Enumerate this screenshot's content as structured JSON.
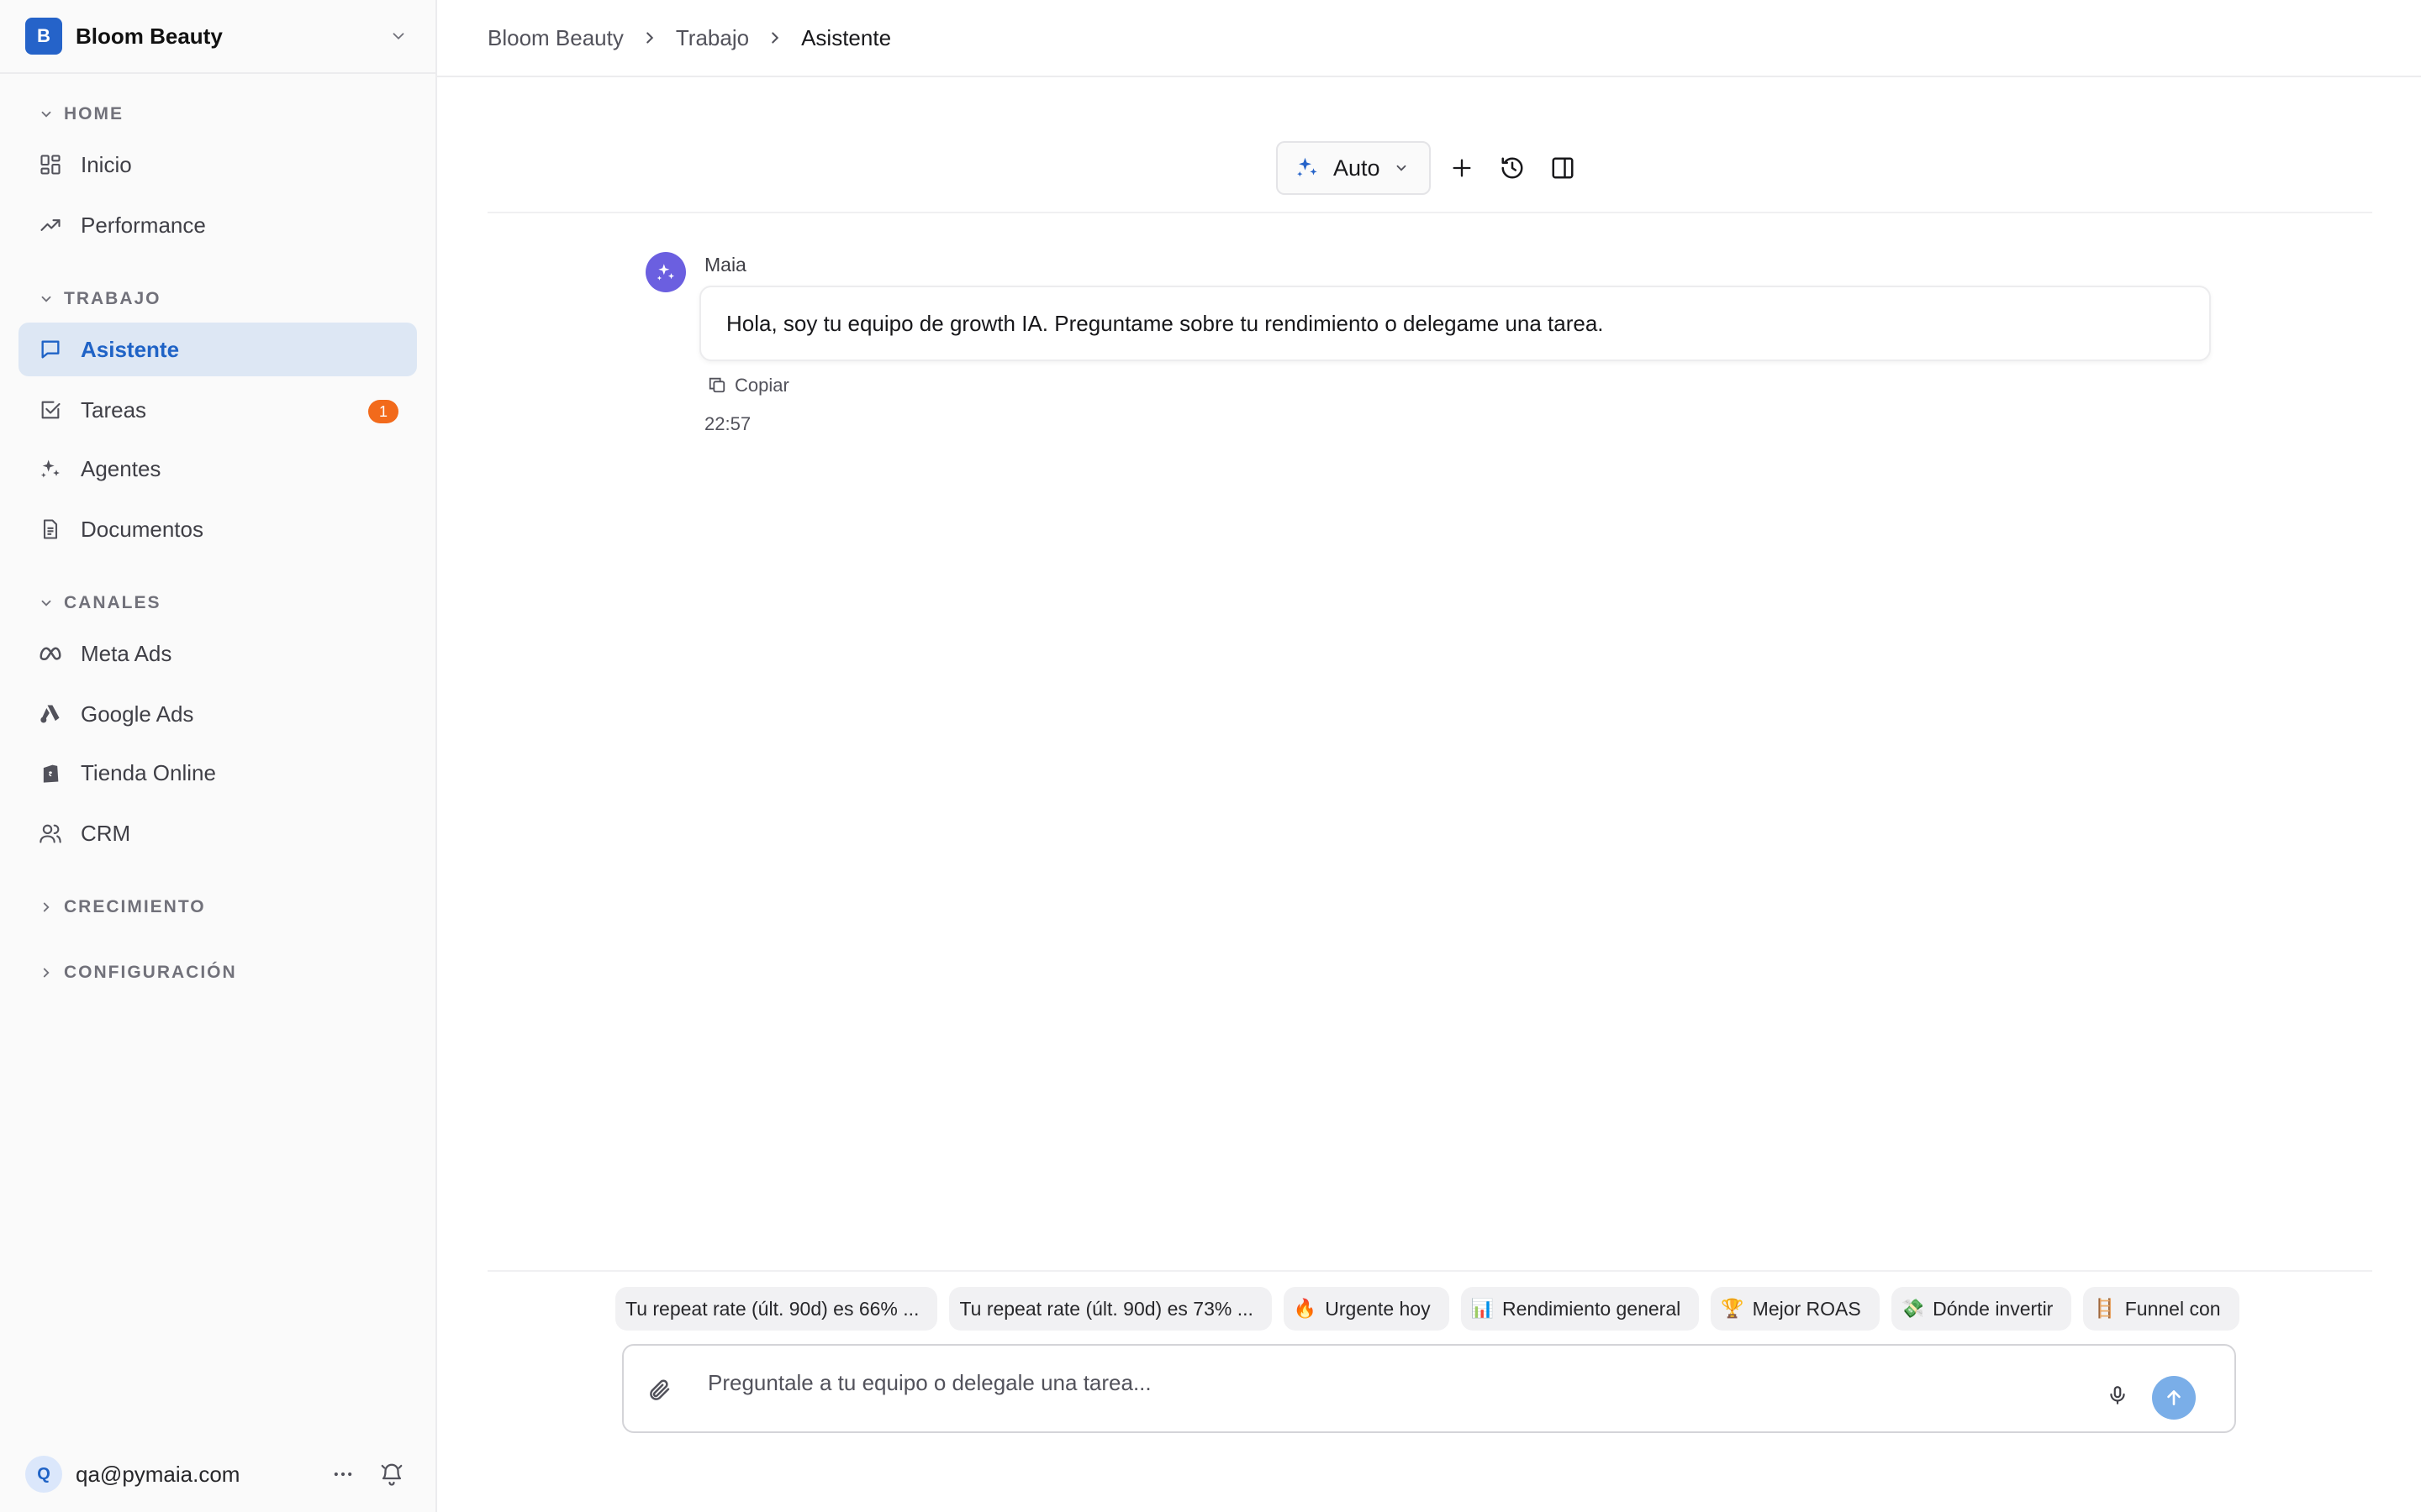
{
  "workspace": {
    "initial": "B",
    "name": "Bloom Beauty"
  },
  "sidebar": {
    "sections": [
      {
        "label": "HOME",
        "items": [
          {
            "label": "Inicio",
            "icon": "grid-icon"
          },
          {
            "label": "Performance",
            "icon": "trending-up-icon"
          }
        ]
      },
      {
        "label": "TRABAJO",
        "items": [
          {
            "label": "Asistente",
            "icon": "chat-icon",
            "active": true
          },
          {
            "label": "Tareas",
            "icon": "checkbox-icon",
            "badge": "1"
          },
          {
            "label": "Agentes",
            "icon": "sparkles-icon"
          },
          {
            "label": "Documentos",
            "icon": "document-icon"
          }
        ]
      },
      {
        "label": "CANALES",
        "items": [
          {
            "label": "Meta Ads",
            "icon": "meta-icon"
          },
          {
            "label": "Google Ads",
            "icon": "google-ads-icon"
          },
          {
            "label": "Tienda Online",
            "icon": "shopify-bag-icon"
          },
          {
            "label": "CRM",
            "icon": "users-icon"
          }
        ]
      },
      {
        "label": "CRECIMIENTO",
        "collapsed": true
      },
      {
        "label": "CONFIGURACIÓN",
        "collapsed": true
      }
    ]
  },
  "user": {
    "initial": "Q",
    "email": "qa@pymaia.com"
  },
  "breadcrumb": [
    "Bloom Beauty",
    "Trabajo",
    "Asistente"
  ],
  "toolbar": {
    "mode_label": "Auto"
  },
  "message": {
    "author": "Maia",
    "text": "Hola, soy tu equipo de growth IA. Preguntame sobre tu rendimiento o delegame una tarea.",
    "copy_label": "Copiar",
    "time": "22:57"
  },
  "suggestions": [
    {
      "emoji": "",
      "label": "Tu repeat rate (últ. 90d) es 66% ..."
    },
    {
      "emoji": "",
      "label": "Tu repeat rate (últ. 90d) es 73% ..."
    },
    {
      "emoji": "🔥",
      "label": "Urgente hoy"
    },
    {
      "emoji": "📊",
      "label": "Rendimiento general"
    },
    {
      "emoji": "🏆",
      "label": "Mejor ROAS"
    },
    {
      "emoji": "💸",
      "label": "Dónde invertir"
    },
    {
      "emoji": "🪜",
      "label": "Funnel con"
    }
  ],
  "composer": {
    "placeholder": "Preguntale a tu equipo o delegale una tarea..."
  },
  "colors": {
    "accent": "#1f63c6",
    "active_bg": "#dde7f4",
    "badge": "#f26a1b",
    "avatar_bot": "#6b5fe0",
    "send": "#7aaee8"
  }
}
